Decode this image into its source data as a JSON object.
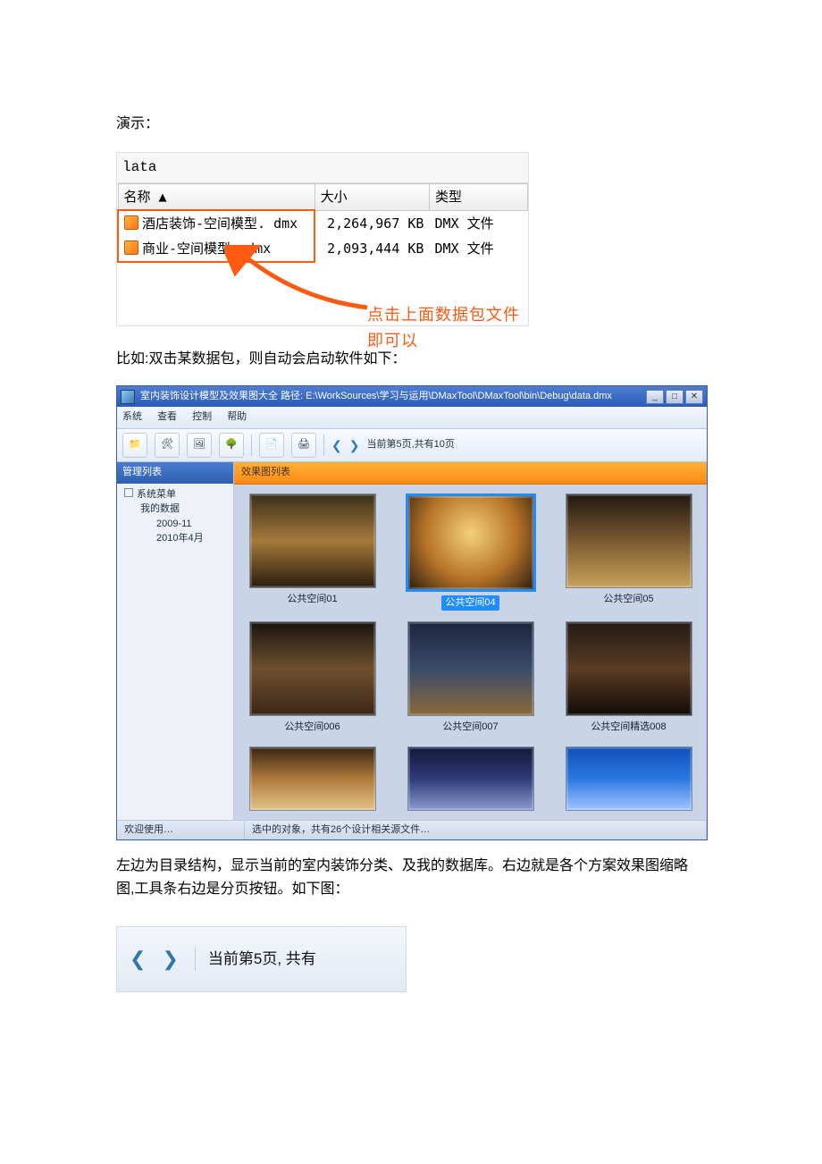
{
  "doc": {
    "heading_demo": "演示：",
    "para_doubleclick": "比如:双击某数据包，则自动会启动软件如下：",
    "para_bottom": "左边为目录结构，显示当前的室内装饰分类、及我的数据库。右边就是各个方案效果图缩略图,工具条右边是分页按钮。如下图："
  },
  "explorer": {
    "path_label": "lata",
    "columns": {
      "name": "名称 ▲",
      "size": "大小",
      "type": "类型"
    },
    "rows": [
      {
        "name": "酒店装饰-空间模型. dmx",
        "size": "2,264,967 KB",
        "type": "DMX 文件"
      },
      {
        "name": "商业-空间模型. dmx",
        "size": "2,093,444 KB",
        "type": "DMX 文件"
      }
    ],
    "hint": "点击上面数据包文件即可以"
  },
  "app": {
    "title": "室内装饰设计模型及效果图大全    路径: E:\\WorkSources\\学习与运用\\DMaxTool\\DMaxTool\\bin\\Debug\\data.dmx",
    "menus": [
      "系统",
      "查看",
      "控制",
      "帮助"
    ],
    "toolbar": {
      "icons": [
        "folder-icon",
        "tools-icon",
        "picture-icon",
        "tree-icon",
        "doc-icon",
        "print-icon"
      ],
      "pager_label": "当前第5页,共有10页"
    },
    "sidebar": {
      "title": "管理列表",
      "nodes": [
        {
          "level": 1,
          "label": "系统菜单",
          "expander": "⊟"
        },
        {
          "level": 2,
          "label": "我的数据"
        },
        {
          "level": 3,
          "label": "2009-11"
        },
        {
          "level": 3,
          "label": "2010年4月"
        }
      ]
    },
    "main_title": "效果图列表",
    "thumbs": [
      {
        "label": "公共空间01",
        "cls": "t1"
      },
      {
        "label": "公共空间04",
        "cls": "t2",
        "selected": true
      },
      {
        "label": "公共空间05",
        "cls": "t3"
      },
      {
        "label": "公共空间006",
        "cls": "t4"
      },
      {
        "label": "公共空间007",
        "cls": "t5"
      },
      {
        "label": "公共空间精选008",
        "cls": "t6"
      },
      {
        "label": "",
        "cls": "t7",
        "partial": true
      },
      {
        "label": "",
        "cls": "t8",
        "partial": true
      },
      {
        "label": "",
        "cls": "t9",
        "partial": true
      }
    ],
    "status": {
      "left": "欢迎使用…",
      "right": "选中的对象，共有26个设计相关源文件…"
    }
  },
  "pager_snippet": {
    "label": "当前第5页, 共有"
  }
}
